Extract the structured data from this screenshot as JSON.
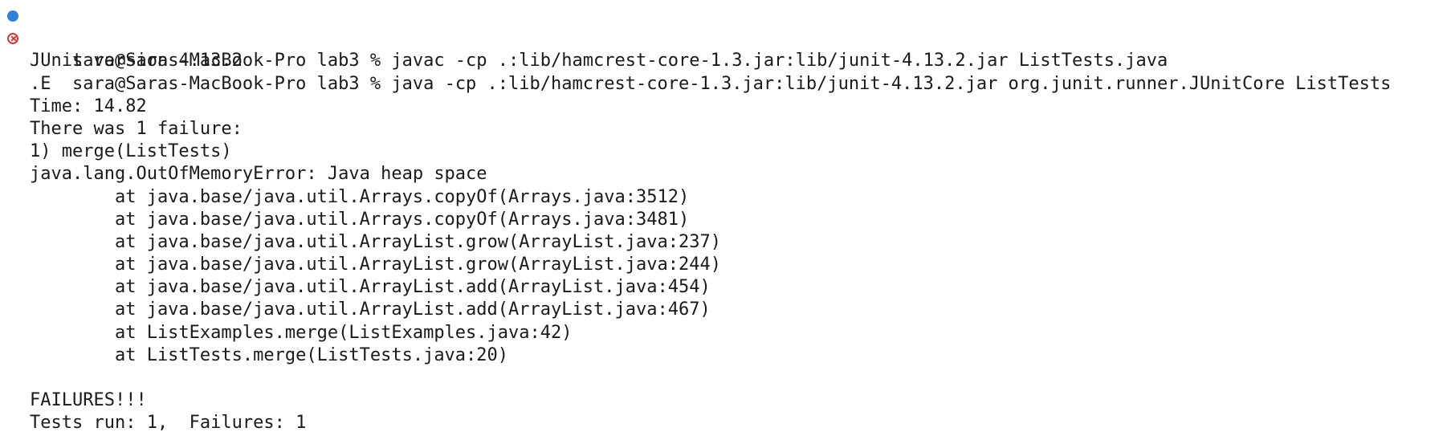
{
  "terminal": {
    "commands": [
      {
        "prompt": "sara@Saras-MacBook-Pro lab3 % ",
        "command": "javac -cp .:lib/hamcrest-core-1.3.jar:lib/junit-4.13.2.jar ListTests.java",
        "status": "success",
        "status_icon": "blue-dot-icon"
      },
      {
        "prompt": "sara@Saras-MacBook-Pro lab3 % ",
        "command": "java -cp .:lib/hamcrest-core-1.3.jar:lib/junit-4.13.2.jar org.junit.runner.JUnitCore ListTests",
        "status": "error",
        "status_icon": "error-circle-x-icon"
      }
    ],
    "output": [
      "JUnit version 4.13.2",
      ".E",
      "Time: 14.82",
      "There was 1 failure:",
      "1) merge(ListTests)",
      "java.lang.OutOfMemoryError: Java heap space",
      "        at java.base/java.util.Arrays.copyOf(Arrays.java:3512)",
      "        at java.base/java.util.Arrays.copyOf(Arrays.java:3481)",
      "        at java.base/java.util.ArrayList.grow(ArrayList.java:237)",
      "        at java.base/java.util.ArrayList.grow(ArrayList.java:244)",
      "        at java.base/java.util.ArrayList.add(ArrayList.java:454)",
      "        at java.base/java.util.ArrayList.add(ArrayList.java:467)",
      "        at ListExamples.merge(ListExamples.java:42)",
      "        at ListTests.merge(ListTests.java:20)",
      "",
      "FAILURES!!!",
      "Tests run: 1,  Failures: 1"
    ]
  },
  "colors": {
    "background": "#ffffff",
    "text": "#1a1a1a",
    "success_marker": "#2f7fd6",
    "error_marker": "#d03b3b"
  }
}
